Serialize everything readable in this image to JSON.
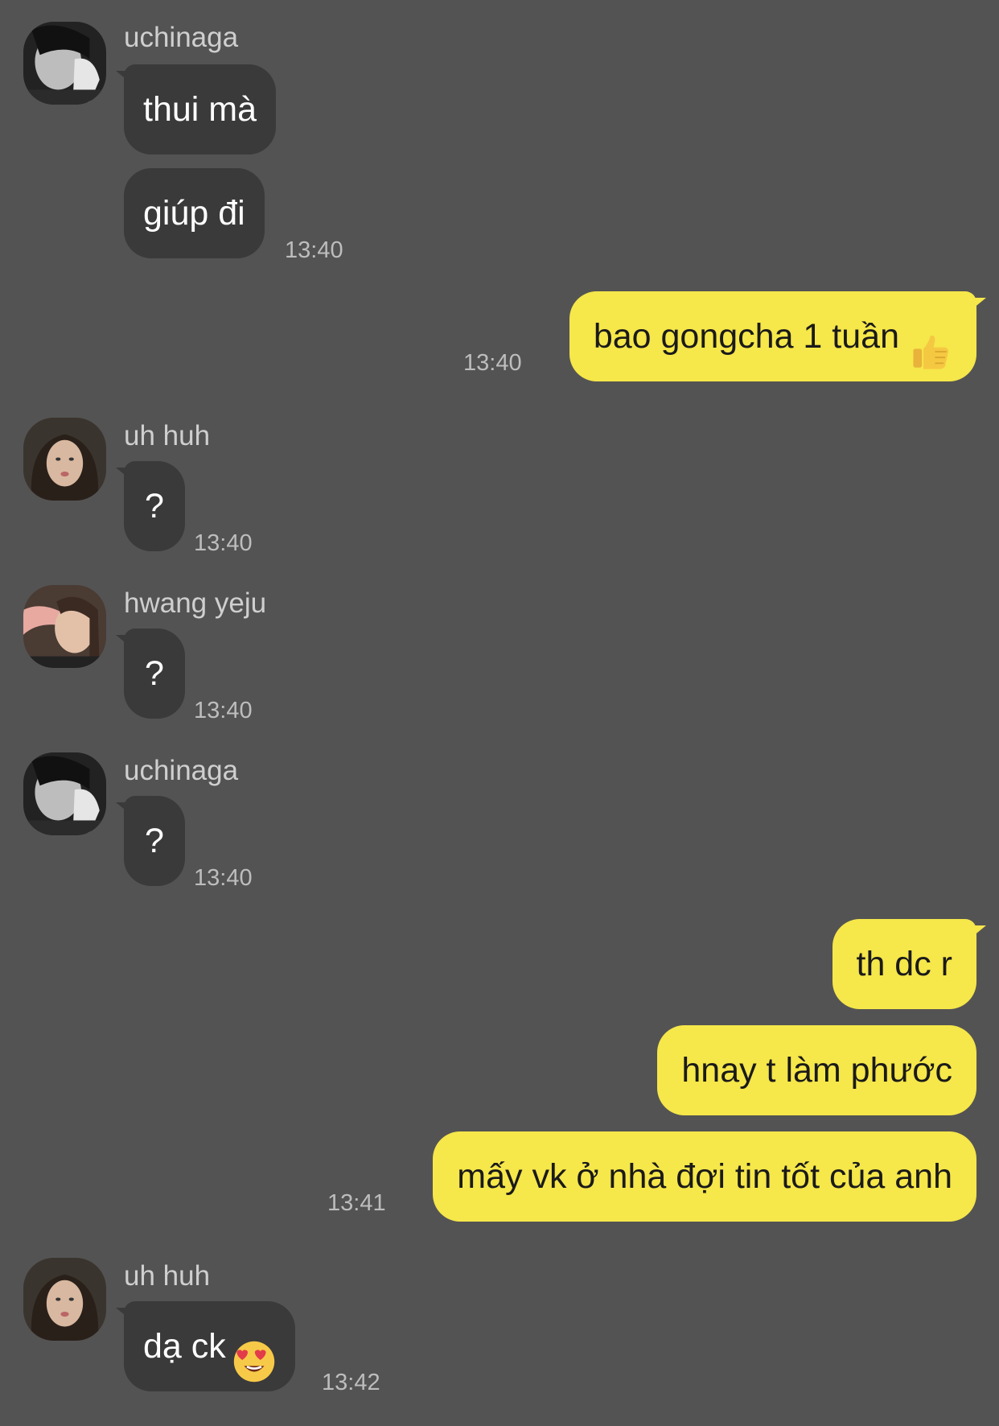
{
  "messages": [
    {
      "sender": "uchinaga",
      "lines": [
        "thui mà",
        "giúp đi"
      ],
      "time": "13:40"
    },
    {
      "sender": "me",
      "lines": [
        "bao gongcha 1 tuần"
      ],
      "time": "13:40"
    },
    {
      "sender": "uh huh",
      "lines": [
        "?"
      ],
      "time": "13:40"
    },
    {
      "sender": "hwang yeju",
      "lines": [
        "?"
      ],
      "time": "13:40"
    },
    {
      "sender": "uchinaga",
      "lines": [
        "?"
      ],
      "time": "13:40"
    },
    {
      "sender": "me",
      "lines": [
        "th dc r",
        "hnay t làm phước",
        "mấy vk ở nhà đợi tin tốt của anh"
      ],
      "time": "13:41"
    },
    {
      "sender": "uh huh",
      "lines": [
        "dạ ck"
      ],
      "time": "13:42"
    }
  ],
  "emojis": {
    "thumbs_up": "thumbs-up-emoji",
    "heart_eyes": "heart-eyes-emoji"
  },
  "colors": {
    "background": "#545353",
    "incoming_bubble": "#3a3a3a",
    "outgoing_bubble": "#f6e74a"
  }
}
